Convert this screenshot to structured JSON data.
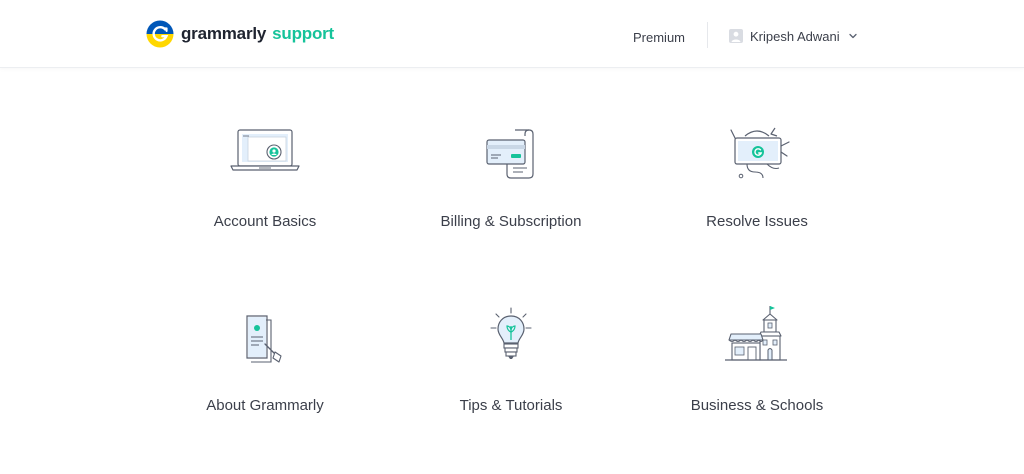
{
  "header": {
    "logo_word": "grammarly",
    "logo_support": "support",
    "premium_label": "Premium",
    "user_name": "Kripesh Adwani"
  },
  "colors": {
    "accent_green": "#15c39a",
    "logo_blue": "#0057b8",
    "logo_yellow": "#ffd700",
    "text": "#3b3f4a",
    "icon_stroke": "#5a6170"
  },
  "categories": [
    {
      "label": "Account Basics",
      "icon": "laptop-icon"
    },
    {
      "label": "Billing & Subscription",
      "icon": "billing-card-icon"
    },
    {
      "label": "Resolve Issues",
      "icon": "toolbox-icon"
    },
    {
      "label": "About Grammarly",
      "icon": "document-pen-icon"
    },
    {
      "label": "Tips & Tutorials",
      "icon": "lightbulb-icon"
    },
    {
      "label": "Business & Schools",
      "icon": "school-building-icon"
    }
  ]
}
